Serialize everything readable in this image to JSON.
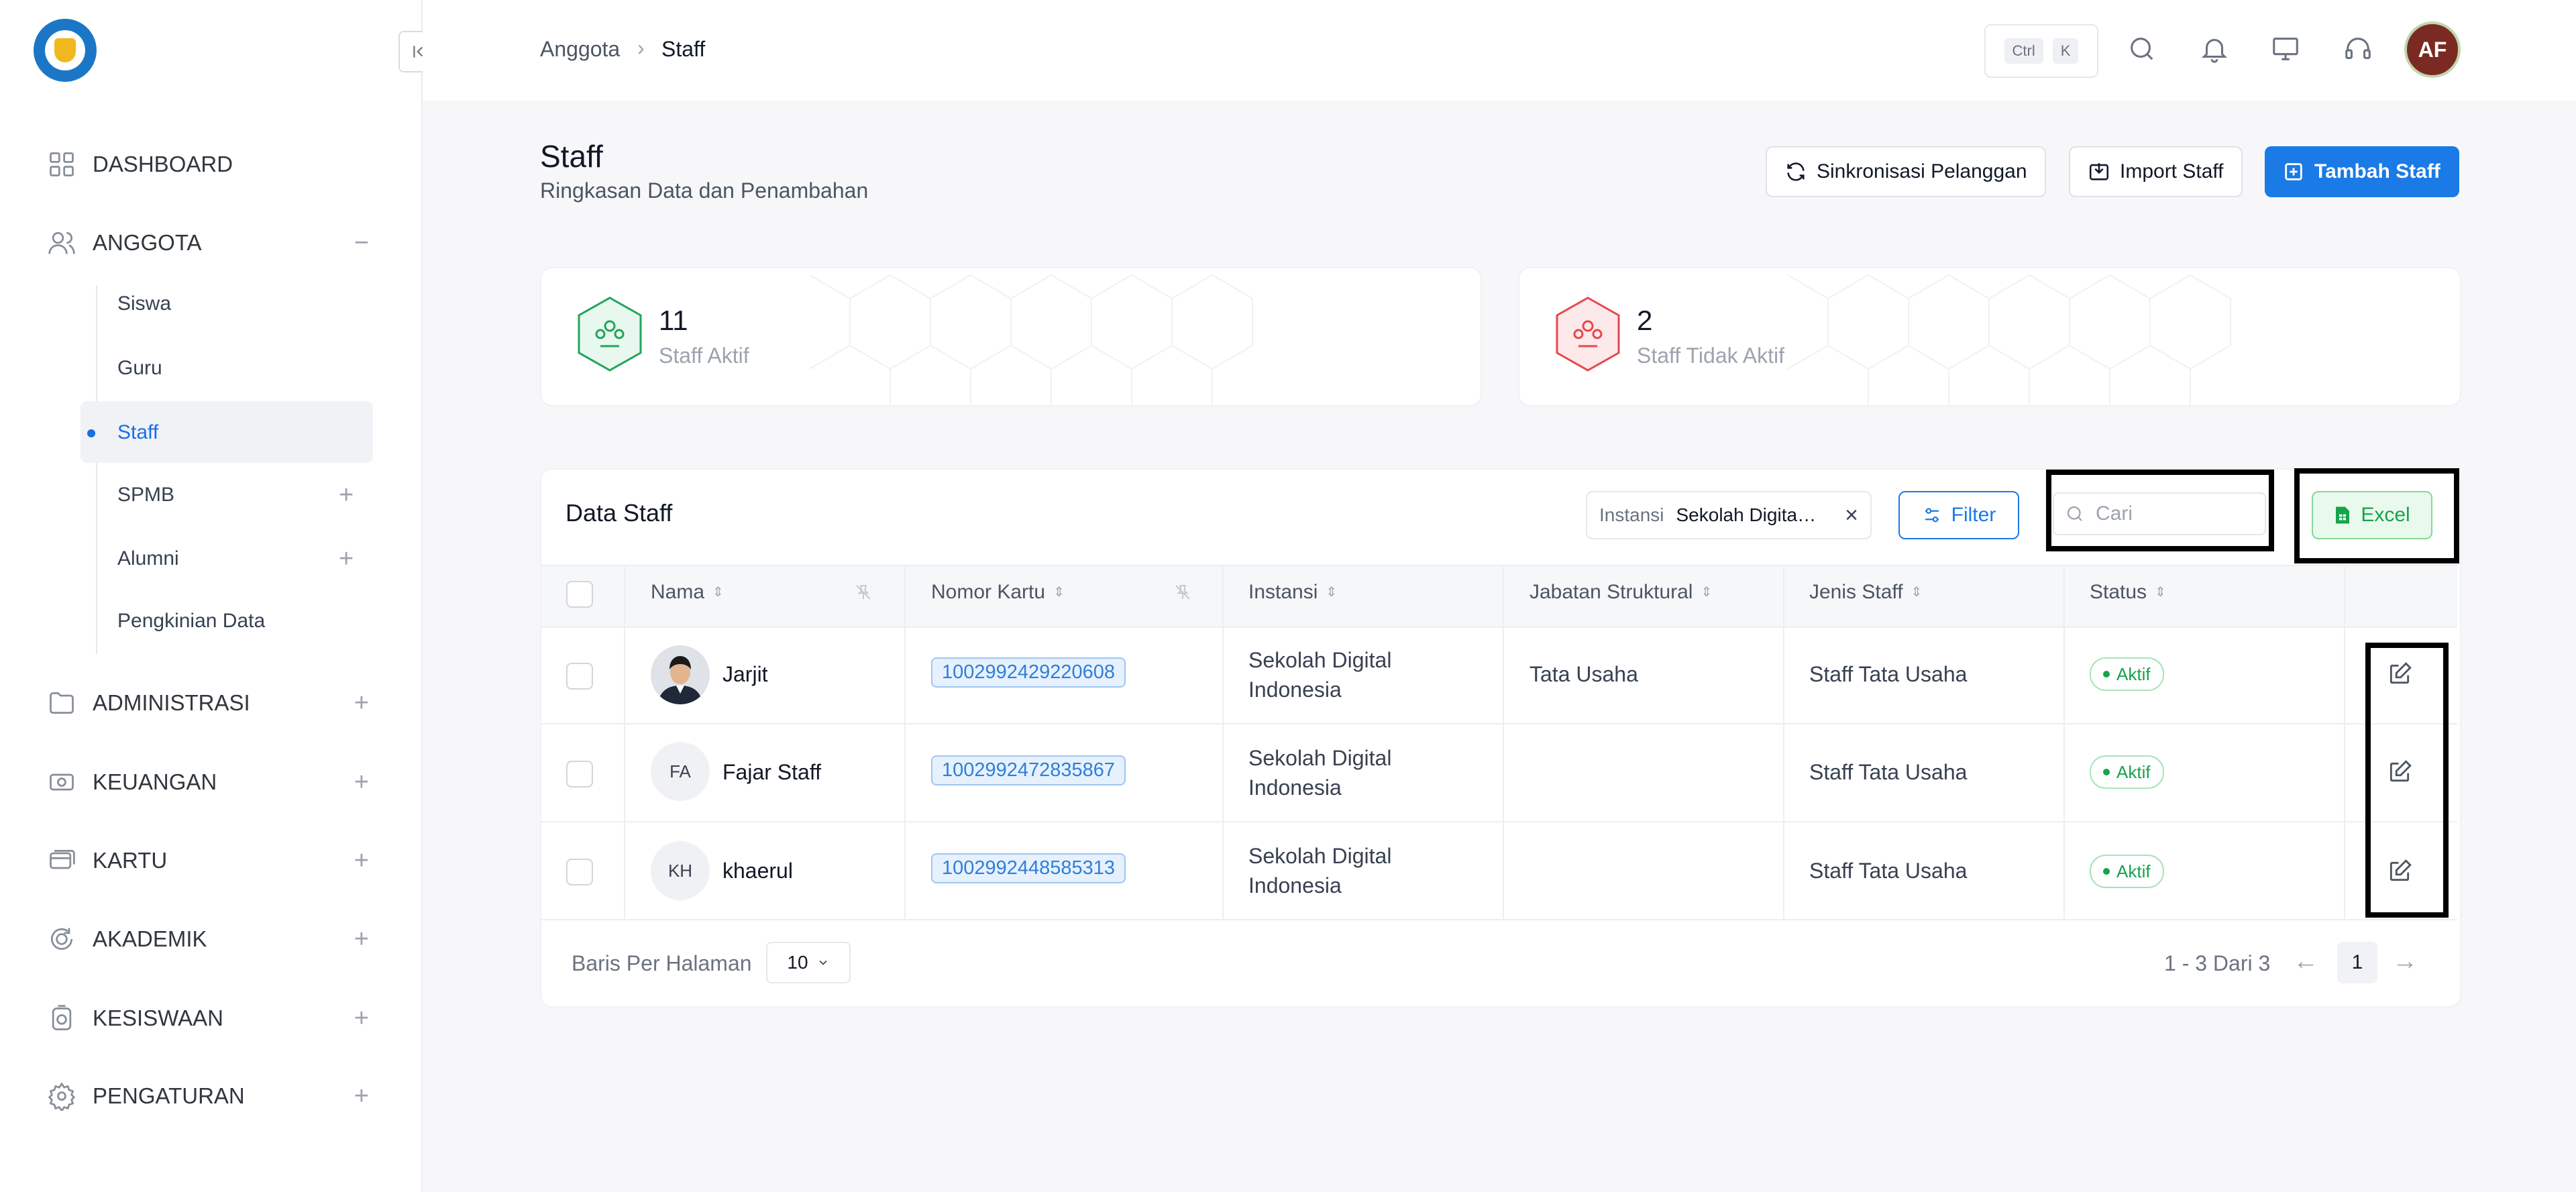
{
  "breadcrumb": {
    "parent": "Anggota",
    "separator": "›",
    "current": "Staff"
  },
  "shortcut": {
    "key1": "Ctrl",
    "key2": "K"
  },
  "user": {
    "initials": "AF"
  },
  "sidebar": {
    "items": [
      {
        "label": "DASHBOARD",
        "icon": "grid-icon"
      },
      {
        "label": "ANGGOTA",
        "icon": "users-icon",
        "expander": "−"
      },
      {
        "label": "ADMINISTRASI",
        "icon": "folder-icon",
        "expander": "+"
      },
      {
        "label": "KEUANGAN",
        "icon": "money-icon",
        "expander": "+"
      },
      {
        "label": "KARTU",
        "icon": "card-icon",
        "expander": "+"
      },
      {
        "label": "AKADEMIK",
        "icon": "academic-icon",
        "expander": "+"
      },
      {
        "label": "KESISWAAN",
        "icon": "medal-icon",
        "expander": "+"
      },
      {
        "label": "PENGATURAN",
        "icon": "gear-icon",
        "expander": "+"
      }
    ],
    "sub_items": [
      {
        "label": "Siswa"
      },
      {
        "label": "Guru"
      },
      {
        "label": "Staff",
        "active": true
      },
      {
        "label": "SPMB",
        "expander": "+"
      },
      {
        "label": "Alumni",
        "expander": "+"
      },
      {
        "label": "Pengkinian Data"
      }
    ]
  },
  "header": {
    "title": "Staff",
    "subtitle": "Ringkasan Data dan Penambahan",
    "sync_label": "Sinkronisasi Pelanggan",
    "import_label": "Import Staff",
    "add_label": "Tambah Staff"
  },
  "stats": [
    {
      "value": "11",
      "label": "Staff Aktif",
      "color": "#22a45d"
    },
    {
      "value": "2",
      "label": "Staff Tidak Aktif",
      "color": "#e5484d"
    }
  ],
  "table": {
    "title": "Data Staff",
    "filter_chip": {
      "key": "Instansi",
      "value": "Sekolah Digital Indonesia",
      "remove": "×"
    },
    "filter_label": "Filter",
    "search_placeholder": "Cari",
    "excel_label": "Excel",
    "columns": [
      "Nama",
      "Nomor Kartu",
      "Instansi",
      "Jabatan Struktural",
      "Jenis Staff",
      "Status"
    ],
    "rows": [
      {
        "avatar": "photo",
        "name": "Jarjit",
        "card": "1002992429220608",
        "inst1": "Sekolah Digital",
        "inst2": "Indonesia",
        "jabatan": "Tata Usaha",
        "jenis": "Staff Tata Usaha",
        "status": "Aktif"
      },
      {
        "avatar": "FA",
        "name": "Fajar Staff",
        "card": "1002992472835867",
        "inst1": "Sekolah Digital",
        "inst2": "Indonesia",
        "jabatan": "",
        "jenis": "Staff Tata Usaha",
        "status": "Aktif"
      },
      {
        "avatar": "KH",
        "name": "khaerul",
        "card": "1002992448585313",
        "inst1": "Sekolah Digital",
        "inst2": "Indonesia",
        "jabatan": "",
        "jenis": "Staff Tata Usaha",
        "status": "Aktif"
      }
    ],
    "footer": {
      "rows_per_page_label": "Baris Per Halaman",
      "rows_per_page": "10",
      "range": "1 - 3 Dari 3",
      "prev": "←",
      "page": "1",
      "next": "→"
    }
  },
  "colors": {
    "primary": "#1a7ae6",
    "success": "#16a34a",
    "danger": "#e5484d"
  }
}
